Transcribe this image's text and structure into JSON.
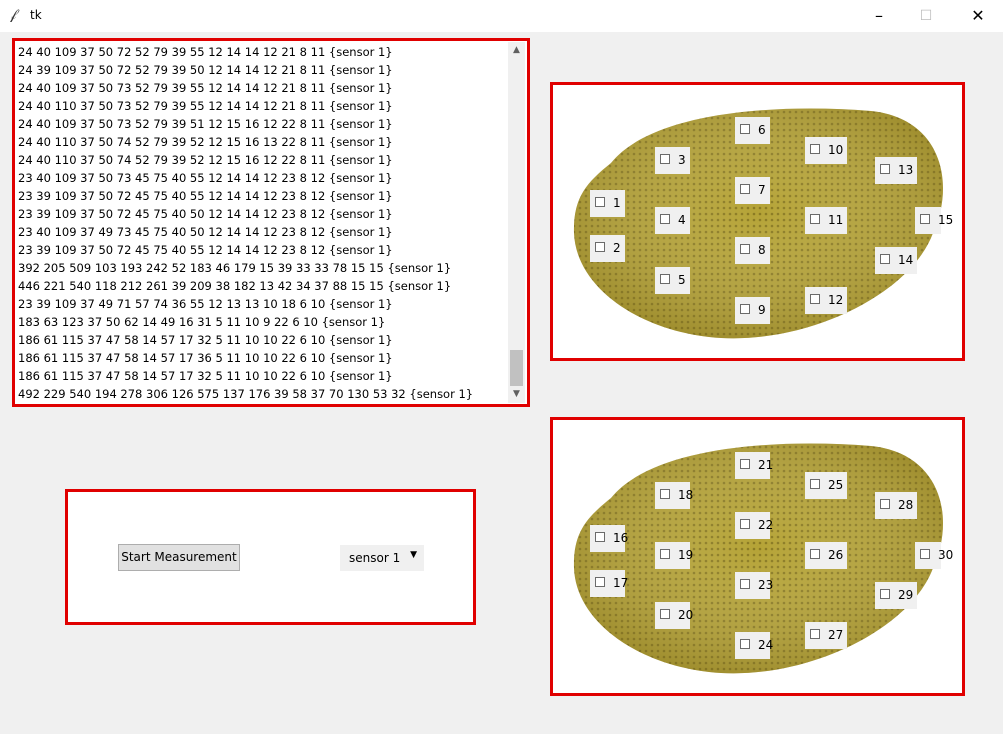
{
  "window": {
    "title": "tk",
    "icon": "feather-icon",
    "minimize_glyph": "–",
    "maximize_glyph": "☐",
    "close_glyph": "✕"
  },
  "log": {
    "lines": [
      "24 40 109 37 50 72 52 79 39 55 12 14 14 12 21 8 11 {sensor 1}",
      "24 39 109 37 50 72 52 79 39 50 12 14 14 12 21 8 11 {sensor 1}",
      "24 40 109 37 50 73 52 79 39 55 12 14 14 12 21 8 11 {sensor 1}",
      "24 40 110 37 50 73 52 79 39 55 12 14 14 12 21 8 11 {sensor 1}",
      "24 40 109 37 50 73 52 79 39 51 12 15 16 12 22 8 11 {sensor 1}",
      "24 40 110 37 50 74 52 79 39 52 12 15 16 13 22 8 11 {sensor 1}",
      "24 40 110 37 50 74 52 79 39 52 12 15 16 12 22 8 11 {sensor 1}",
      "23 40 109 37 50 73 45 75 40 55 12 14 14 12 23 8 12 {sensor 1}",
      "23 39 109 37 50 72 45 75 40 55 12 14 14 12 23 8 12 {sensor 1}",
      "23 39 109 37 50 72 45 75 40 50 12 14 14 12 23 8 12 {sensor 1}",
      "23 40 109 37 49 73 45 75 40 50 12 14 14 12 23 8 12 {sensor 1}",
      "23 39 109 37 50 72 45 75 40 55 12 14 14 12 23 8 12 {sensor 1}",
      "392 205 509 103 193 242 52 183 46 179 15 39 33 33 78 15 15 {sensor 1}",
      "446 221 540 118 212 261 39 209 38 182 13 42 34 37 88 15 15 {sensor 1}",
      "23 39 109 37 49 71 57 74 36 55 12 13 13 10 18 6 10 {sensor 1}",
      "183 63 123 37 50 62 14 49 16 31 5 11 10 9 22 6 10 {sensor 1}",
      "186 61 115 37 47 58 14 57 17 32 5 11 10 10 22 6 10 {sensor 1}",
      "186 61 115 37 47 58 14 57 17 36 5 11 10 10 22 6 10 {sensor 1}",
      "186 61 115 37 47 58 14 57 17 32 5 11 10 10 22 6 10 {sensor 1}",
      "492 229 540 194 278 306 126 575 137 176 39 58 37 70 130 53 32 {sensor 1}"
    ],
    "scroll_up_glyph": "▲",
    "scroll_down_glyph": "▼"
  },
  "controls": {
    "start_label": "Start Measurement",
    "sensor_selected": "sensor 1",
    "dropdown_glyph": "▼"
  },
  "panel1": {
    "image": "jackfruit-image",
    "sensors": [
      "1",
      "2",
      "3",
      "4",
      "5",
      "6",
      "7",
      "8",
      "9",
      "10",
      "11",
      "12",
      "13",
      "14",
      "15"
    ]
  },
  "panel2": {
    "image": "jackfruit-image",
    "sensors": [
      "16",
      "17",
      "18",
      "19",
      "20",
      "21",
      "22",
      "23",
      "24",
      "25",
      "26",
      "27",
      "28",
      "29",
      "30"
    ]
  },
  "colors": {
    "frame": "#e00000",
    "fruit": "#b3a234"
  }
}
